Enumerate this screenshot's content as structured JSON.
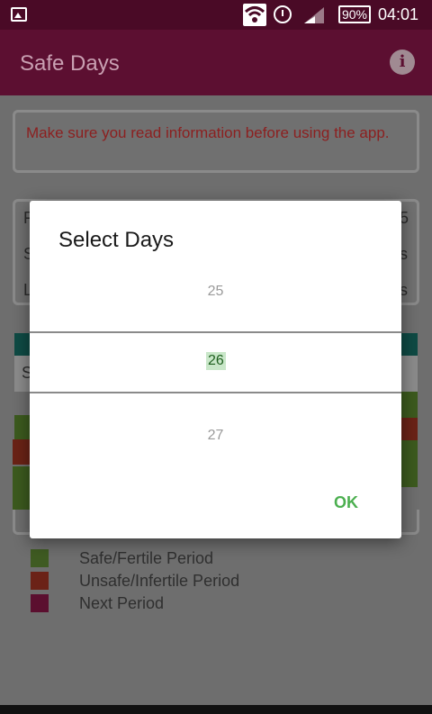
{
  "status_bar": {
    "battery": "90%",
    "time": "04:01"
  },
  "app_bar": {
    "title": "Safe Days",
    "info_icon": "info-icon"
  },
  "notice": {
    "text": "Make sure you read information before using the app."
  },
  "card1": {
    "row_letters": [
      "F",
      "S",
      "L"
    ],
    "row_right": [
      "5",
      "s",
      "s"
    ]
  },
  "grid": {
    "header_letter": "S"
  },
  "legend": [
    {
      "label": "Safe/Fertile Period",
      "color": "#3f5b22"
    },
    {
      "label": "Unsafe/Infertile Period",
      "color": "#6b2217"
    },
    {
      "label": "Next Period",
      "color": "#5b0f2f"
    }
  ],
  "dialog": {
    "title": "Select Days",
    "picker": {
      "prev": "25",
      "selected": "26",
      "next": "27"
    },
    "ok_label": "OK"
  }
}
